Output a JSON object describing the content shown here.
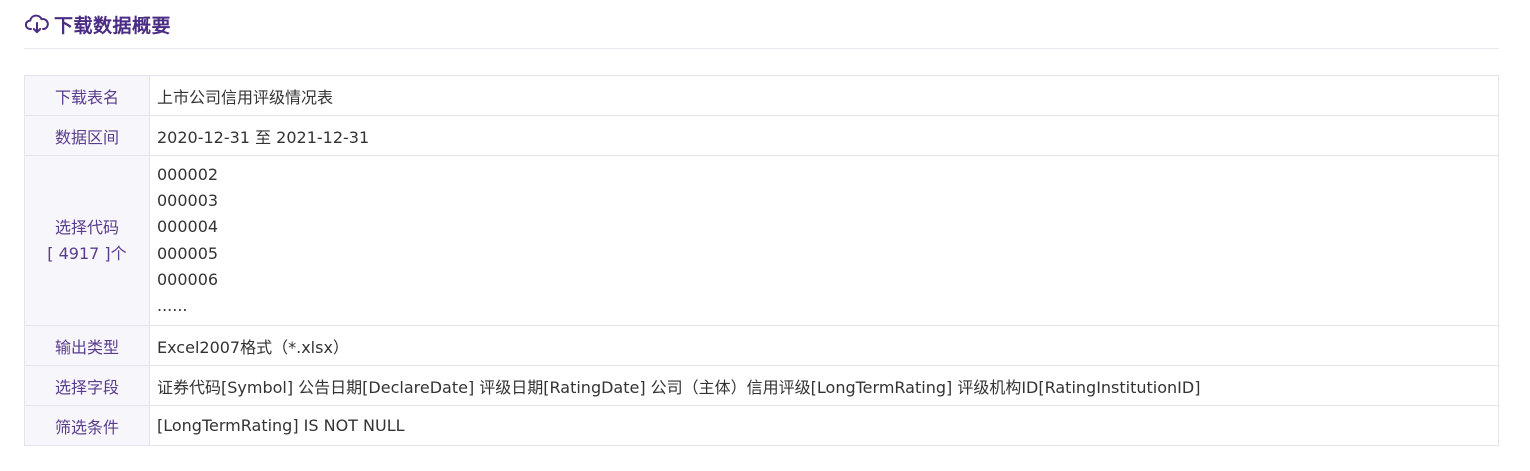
{
  "header": {
    "title": "下载数据概要",
    "icon": "cloud-download-icon",
    "accent_color": "#4b2c84"
  },
  "summary": {
    "rows": [
      {
        "label": "下载表名",
        "value": "上市公司信用评级情况表"
      },
      {
        "label": "数据区间",
        "value": "2020-12-31 至 2021-12-31"
      },
      {
        "label": "选择代码",
        "count_text": "[ 4917 ]个",
        "codes": [
          "000002",
          "000003",
          "000004",
          "000005",
          "000006",
          "......"
        ]
      },
      {
        "label": "输出类型",
        "value": "Excel2007格式（*.xlsx）"
      },
      {
        "label": "选择字段",
        "value": "证券代码[Symbol] 公告日期[DeclareDate] 评级日期[RatingDate] 公司（主体）信用评级[LongTermRating] 评级机构ID[RatingInstitutionID]"
      },
      {
        "label": "筛选条件",
        "value": "[LongTermRating] IS NOT NULL"
      }
    ]
  }
}
